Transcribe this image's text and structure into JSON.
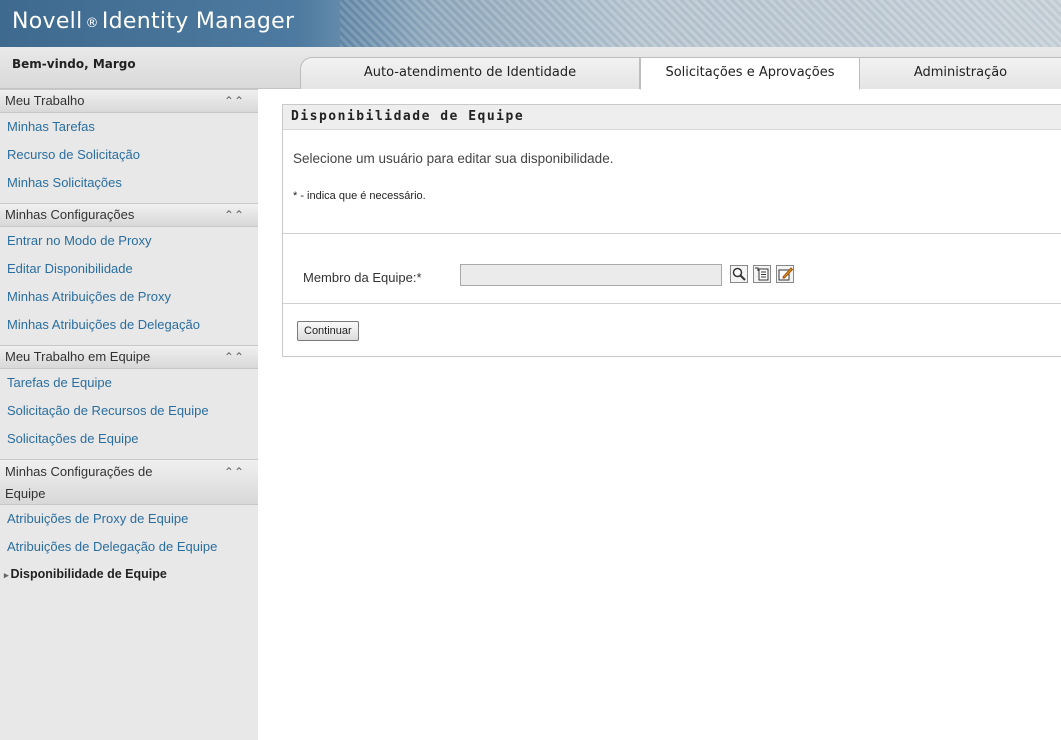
{
  "header": {
    "brand": "Novell",
    "brand_mark": "®",
    "brand_product": "Identity Manager",
    "welcome": "Bem-vindo, Margo"
  },
  "tabs": [
    {
      "label": "Auto-atendimento de Identidade",
      "active": false
    },
    {
      "label": "Solicitações e Aprovações",
      "active": true
    },
    {
      "label": "Administração",
      "active": false
    }
  ],
  "sidebar": {
    "groups": [
      {
        "title": "Meu Trabalho",
        "items": [
          "Minhas Tarefas",
          "Recurso de Solicitação",
          "Minhas Solicitações"
        ]
      },
      {
        "title": "Minhas Configurações",
        "items": [
          "Entrar no Modo de Proxy",
          "Editar Disponibilidade",
          "Minhas Atribuições de Proxy",
          "Minhas Atribuições de Delegação"
        ]
      },
      {
        "title": "Meu Trabalho em Equipe",
        "items": [
          "Tarefas de Equipe",
          "Solicitação de Recursos de Equipe",
          "Solicitações de Equipe"
        ]
      },
      {
        "title": "Minhas Configurações de Equipe",
        "items": [
          "Atribuições de Proxy de Equipe",
          "Atribuições de Delegação de Equipe",
          "Disponibilidade de Equipe"
        ]
      }
    ],
    "current_item": "Disponibilidade de Equipe",
    "collapse_icon": "double-chevron-up-icon"
  },
  "panel": {
    "title": "Disponibilidade de Equipe",
    "intro": "Selecione um usuário para editar sua disponibilidade.",
    "required_note": "* - indica que é necessário.",
    "field_label": "Membro da Equipe:*",
    "field_value": "",
    "icons": [
      "search-icon",
      "history-icon",
      "clear-icon"
    ],
    "continue_label": "Continuar"
  }
}
